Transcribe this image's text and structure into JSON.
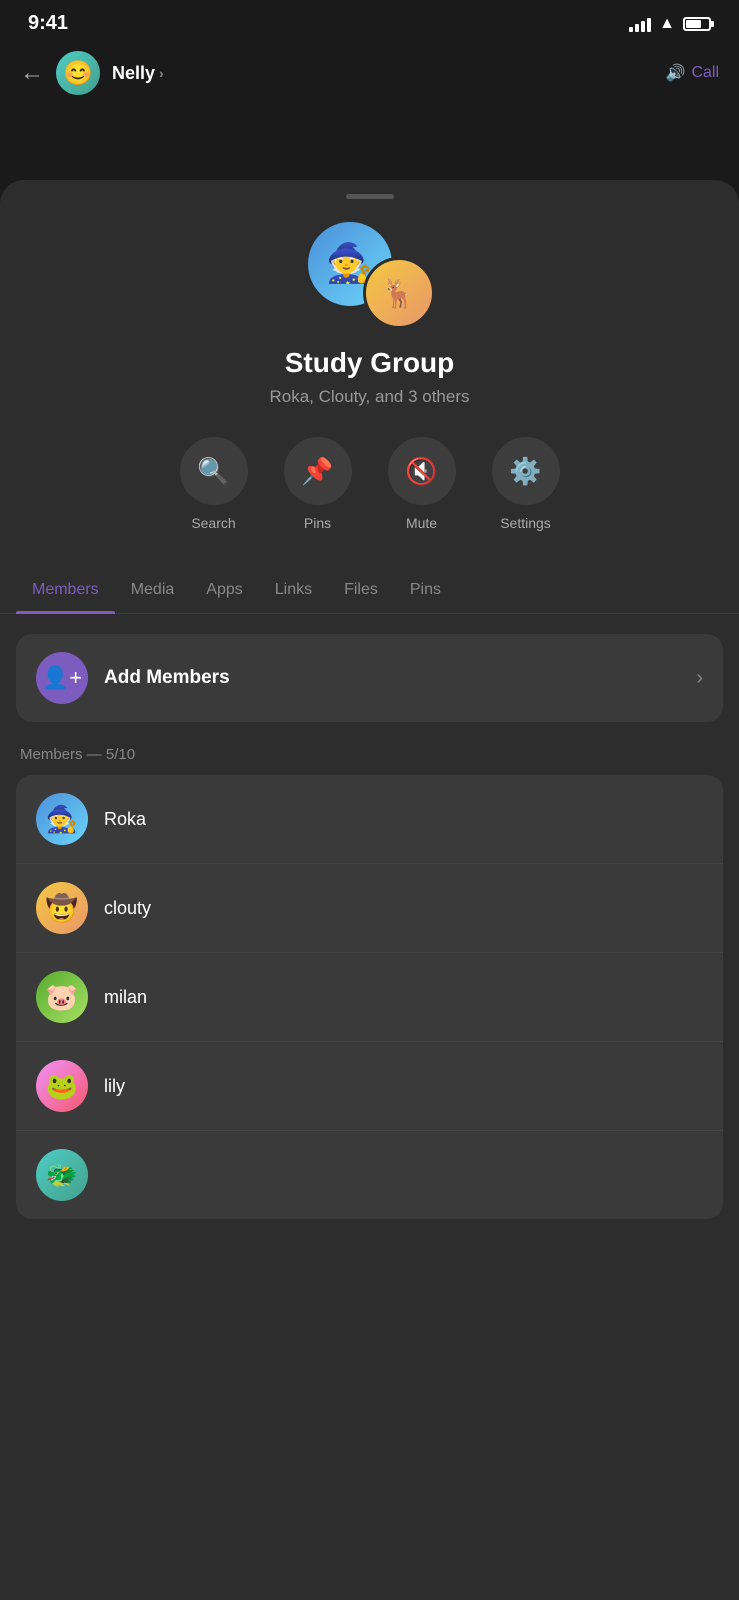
{
  "statusBar": {
    "time": "9:41"
  },
  "header": {
    "backLabel": "←",
    "name": "Nelly",
    "chevron": "›",
    "callLabel": "Call"
  },
  "sheet": {
    "groupName": "Study Group",
    "groupMembersText": "Roka, Clouty, and 3 others",
    "actionButtons": [
      {
        "id": "search",
        "label": "Search",
        "icon": "🔍"
      },
      {
        "id": "pins",
        "label": "Pins",
        "icon": "📌"
      },
      {
        "id": "mute",
        "label": "Mute",
        "icon": "🔇"
      },
      {
        "id": "settings",
        "label": "Settings",
        "icon": "⚙️"
      }
    ],
    "tabs": [
      {
        "id": "members",
        "label": "Members",
        "active": true
      },
      {
        "id": "media",
        "label": "Media",
        "active": false
      },
      {
        "id": "apps",
        "label": "Apps",
        "active": false
      },
      {
        "id": "links",
        "label": "Links",
        "active": false
      },
      {
        "id": "files",
        "label": "Files",
        "active": false
      },
      {
        "id": "pins",
        "label": "Pins",
        "active": false
      }
    ],
    "addMembersLabel": "Add Members",
    "membersSectionTitle": "Members — 5/10",
    "members": [
      {
        "id": "roka",
        "name": "Roka",
        "avatarClass": "avatar-roka",
        "emoji": "🧙"
      },
      {
        "id": "clouty",
        "name": "clouty",
        "avatarClass": "avatar-clouty",
        "emoji": "🤠"
      },
      {
        "id": "milan",
        "name": "milan",
        "avatarClass": "avatar-milan",
        "emoji": "🐷"
      },
      {
        "id": "lily",
        "name": "lily",
        "avatarClass": "avatar-lily",
        "emoji": "🐸"
      },
      {
        "id": "last",
        "name": "",
        "avatarClass": "avatar-last",
        "emoji": "🐲"
      }
    ]
  }
}
